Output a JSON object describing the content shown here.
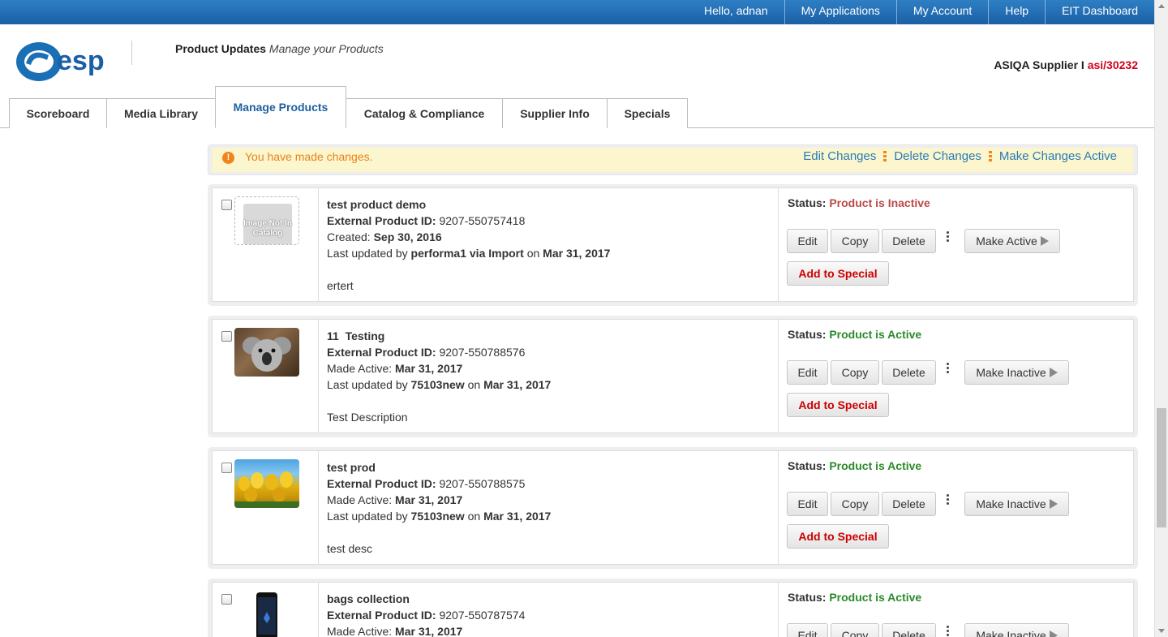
{
  "topbar": {
    "links": [
      "Hello, adnan",
      "My Applications",
      "My Account",
      "Help",
      "EIT Dashboard"
    ]
  },
  "header": {
    "title_bold": "Product Updates",
    "title_italic": "Manage your Products",
    "supplier_label": "ASIQA Supplier",
    "supplier_sep": " I ",
    "supplier_id": "asi/30232"
  },
  "tabs": [
    "Scoreboard",
    "Media Library",
    "Manage Products",
    "Catalog & Compliance",
    "Supplier Info",
    "Specials"
  ],
  "active_tab": "Manage Products",
  "notice": {
    "message": "You have made changes.",
    "links": [
      "Edit Changes",
      "Delete Changes",
      "Make Changes Active"
    ]
  },
  "products": [
    {
      "name": "test product demo",
      "external_id_label": "External Product ID:",
      "external_id": "9207-550757418",
      "date_label": "Created:",
      "date": "Sep 30, 2016",
      "updated_prefix": "Last updated by",
      "updated_by": "performa1 via Import",
      "updated_on": "on",
      "updated_date": "Mar 31, 2017",
      "description": "ertert",
      "status_label": "Status:",
      "status": "Product is Inactive",
      "toggle_label": "Make Active",
      "image": "Image Not In Catalog"
    },
    {
      "name": "11  Testing",
      "external_id_label": "External Product ID:",
      "external_id": "9207-550788576",
      "date_label": "Made Active:",
      "date": "Mar 31, 2017",
      "updated_prefix": "Last updated by",
      "updated_by": "75103new",
      "updated_on": "on",
      "updated_date": "Mar 31, 2017",
      "description": "Test Description",
      "status_label": "Status:",
      "status": "Product is Active",
      "toggle_label": "Make Inactive",
      "image": "koala-photo"
    },
    {
      "name": "test prod",
      "external_id_label": "External Product ID:",
      "external_id": "9207-550788575",
      "date_label": "Made Active:",
      "date": "Mar 31, 2017",
      "updated_prefix": "Last updated by",
      "updated_by": "75103new",
      "updated_on": "on",
      "updated_date": "Mar 31, 2017",
      "description": "test desc",
      "status_label": "Status:",
      "status": "Product is Active",
      "toggle_label": "Make Inactive",
      "image": "tulips-photo"
    },
    {
      "name": "bags collection",
      "external_id_label": "External Product ID:",
      "external_id": "9207-550787574",
      "date_label": "Made Active:",
      "date": "Mar 31, 2017",
      "status_label": "Status:",
      "status": "Product is Active",
      "toggle_label": "Make Inactive",
      "image": "phone-photo"
    }
  ],
  "actions": {
    "edit": "Edit",
    "copy": "Copy",
    "delete": "Delete",
    "add_special": "Add to Special"
  },
  "colors": {
    "topbar": "#1a5fa6",
    "inactive": "#b94a48",
    "active": "#2a8a2a",
    "notice_bg": "#fbf6cd",
    "notice_text": "#e8821b",
    "link": "#2a7ab9",
    "accent_red": "#d0021b"
  }
}
